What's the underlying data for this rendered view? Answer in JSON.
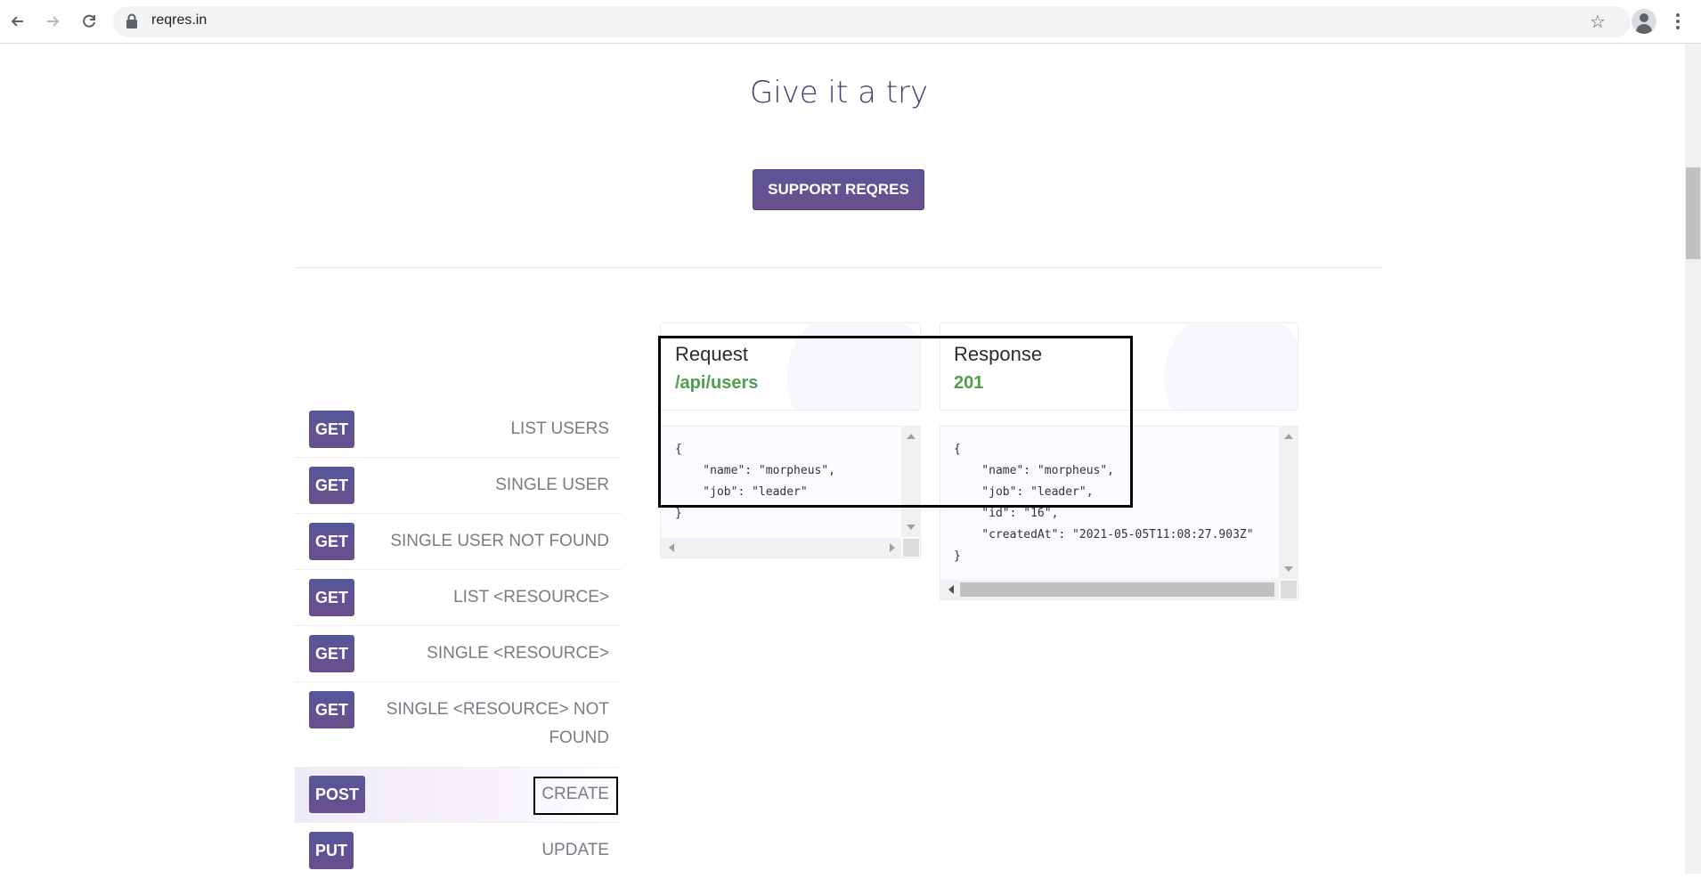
{
  "browser": {
    "url": "reqres.in"
  },
  "page": {
    "headline": "Give it a try",
    "support_button": "SUPPORT REQRES"
  },
  "endpoints": [
    {
      "method": "GET",
      "label": "LIST USERS"
    },
    {
      "method": "GET",
      "label": "SINGLE USER"
    },
    {
      "method": "GET",
      "label": "SINGLE USER NOT FOUND"
    },
    {
      "method": "GET",
      "label": "LIST <RESOURCE>"
    },
    {
      "method": "GET",
      "label": "SINGLE <RESOURCE>"
    },
    {
      "method": "GET",
      "label_line1": "SINGLE <RESOURCE> NOT",
      "label_line2": "FOUND"
    },
    {
      "method": "POST",
      "label": "CREATE"
    },
    {
      "method": "PUT",
      "label": "UPDATE"
    }
  ],
  "request": {
    "title": "Request",
    "path": "/api/users",
    "body_lines": [
      "{",
      "    \"name\": \"morpheus\",",
      "    \"job\": \"leader\"",
      "}"
    ]
  },
  "response": {
    "title": "Response",
    "status": "201",
    "body_lines": [
      "{",
      "    \"name\": \"morpheus\",",
      "    \"job\": \"leader\",",
      "    \"id\": \"16\",",
      "    \"createdAt\": \"2021-05-05T11:08:27.903Z\"",
      "}"
    ]
  }
}
